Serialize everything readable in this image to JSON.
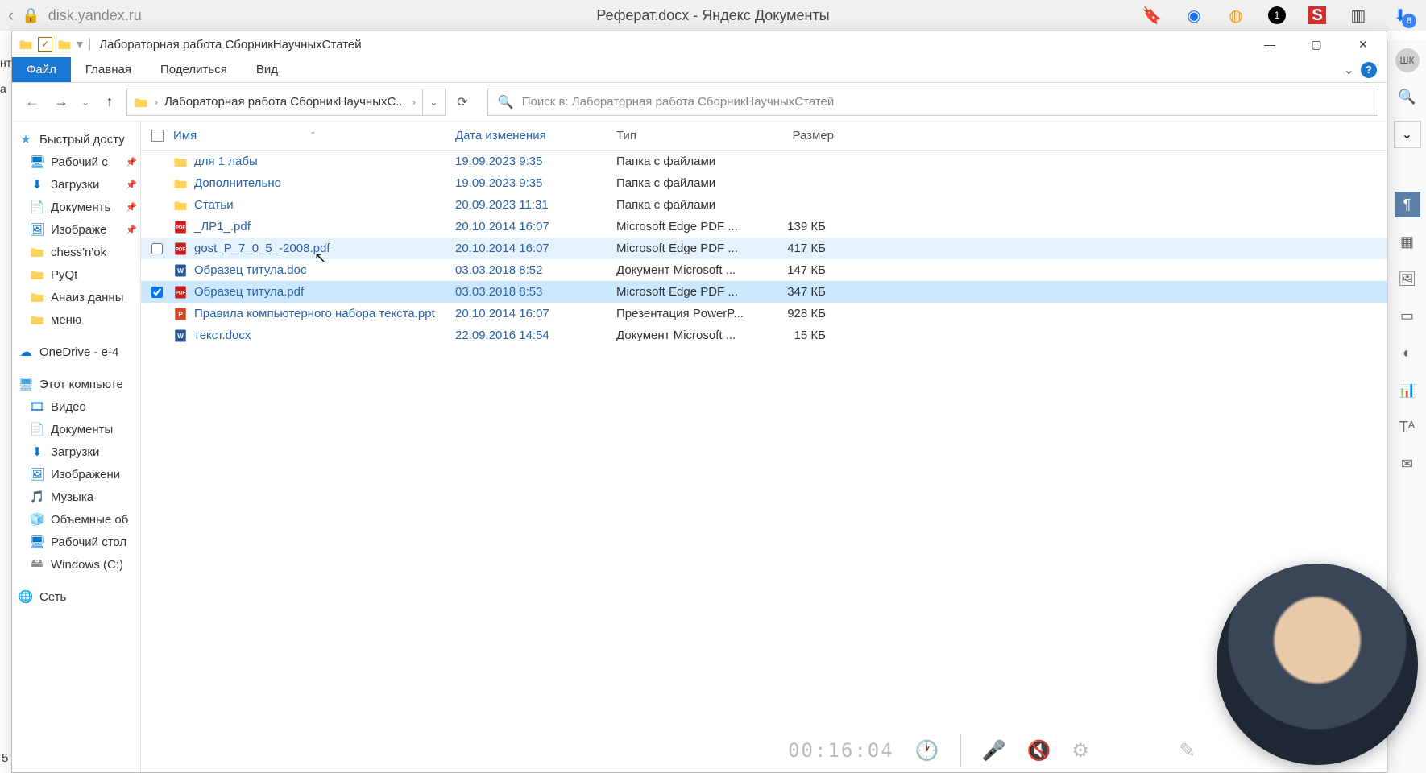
{
  "browser": {
    "url": "disk.yandex.ru",
    "tab_title": "Реферат.docx - Яндекс Документы",
    "download_badge": "8"
  },
  "right_toolbar": {
    "avatar": "ШК"
  },
  "explorer": {
    "window_title": "Лабораторная работа СборникНаучныхСтатей",
    "ribbon": {
      "file": "Файл",
      "tabs": [
        "Главная",
        "Поделиться",
        "Вид"
      ]
    },
    "address": {
      "crumb": "Лабораторная работа СборникНаучныхС...",
      "search_placeholder": "Поиск в: Лабораторная работа СборникНаучныхСтатей"
    },
    "tree": {
      "quick_access": "Быстрый досту",
      "quick_items": [
        {
          "label": "Рабочий с",
          "icon": "desktop",
          "pinned": true
        },
        {
          "label": "Загрузки",
          "icon": "downloads",
          "pinned": true
        },
        {
          "label": "Документь",
          "icon": "documents",
          "pinned": true
        },
        {
          "label": "Изображе",
          "icon": "pictures",
          "pinned": true
        },
        {
          "label": "chess'n'ok",
          "icon": "folder",
          "pinned": false
        },
        {
          "label": "PyQt",
          "icon": "folder",
          "pinned": false
        },
        {
          "label": "Анаиз данны",
          "icon": "folder",
          "pinned": false
        },
        {
          "label": "меню",
          "icon": "folder",
          "pinned": false
        }
      ],
      "onedrive": "OneDrive - e-4",
      "this_pc": "Этот компьюте",
      "pc_items": [
        {
          "label": "Видео",
          "icon": "video"
        },
        {
          "label": "Документы",
          "icon": "documents"
        },
        {
          "label": "Загрузки",
          "icon": "downloads"
        },
        {
          "label": "Изображени",
          "icon": "pictures"
        },
        {
          "label": "Музыка",
          "icon": "music"
        },
        {
          "label": "Объемные об",
          "icon": "3d"
        },
        {
          "label": "Рабочий стол",
          "icon": "desktop"
        },
        {
          "label": "Windows  (C:)",
          "icon": "drive"
        }
      ],
      "network": "Сеть"
    },
    "columns": {
      "name": "Имя",
      "date": "Дата изменения",
      "type": "Тип",
      "size": "Размер"
    },
    "files": [
      {
        "name": "для 1 лабы",
        "date": "19.09.2023 9:35",
        "type": "Папка с файлами",
        "size": "",
        "icon": "folder",
        "checked": false,
        "state": ""
      },
      {
        "name": "Дополнительно",
        "date": "19.09.2023 9:35",
        "type": "Папка с файлами",
        "size": "",
        "icon": "folder",
        "checked": false,
        "state": ""
      },
      {
        "name": "Статьи",
        "date": "20.09.2023 11:31",
        "type": "Папка с файлами",
        "size": "",
        "icon": "folder",
        "checked": false,
        "state": ""
      },
      {
        "name": "_ЛР1_.pdf",
        "date": "20.10.2014 16:07",
        "type": "Microsoft Edge PDF ...",
        "size": "139 КБ",
        "icon": "pdf",
        "checked": false,
        "state": ""
      },
      {
        "name": "gost_P_7_0_5_-2008.pdf",
        "date": "20.10.2014 16:07",
        "type": "Microsoft Edge PDF ...",
        "size": "417 КБ",
        "icon": "pdf",
        "checked": false,
        "state": "hover"
      },
      {
        "name": "Образец титула.doc",
        "date": "03.03.2018 8:52",
        "type": "Документ Microsoft ...",
        "size": "147 КБ",
        "icon": "word",
        "checked": false,
        "state": ""
      },
      {
        "name": "Образец титула.pdf",
        "date": "03.03.2018 8:53",
        "type": "Microsoft Edge PDF ...",
        "size": "347 КБ",
        "icon": "pdf",
        "checked": true,
        "state": "selected"
      },
      {
        "name": "Правила компьютерного набора текста.ppt",
        "date": "20.10.2014 16:07",
        "type": "Презентация PowerP...",
        "size": "928 КБ",
        "icon": "ppt",
        "checked": false,
        "state": ""
      },
      {
        "name": "текст.docx",
        "date": "22.09.2016 14:54",
        "type": "Документ Microsoft ...",
        "size": "15 КБ",
        "icon": "word",
        "checked": false,
        "state": ""
      }
    ]
  },
  "recording": {
    "timer": "00:16:04"
  }
}
